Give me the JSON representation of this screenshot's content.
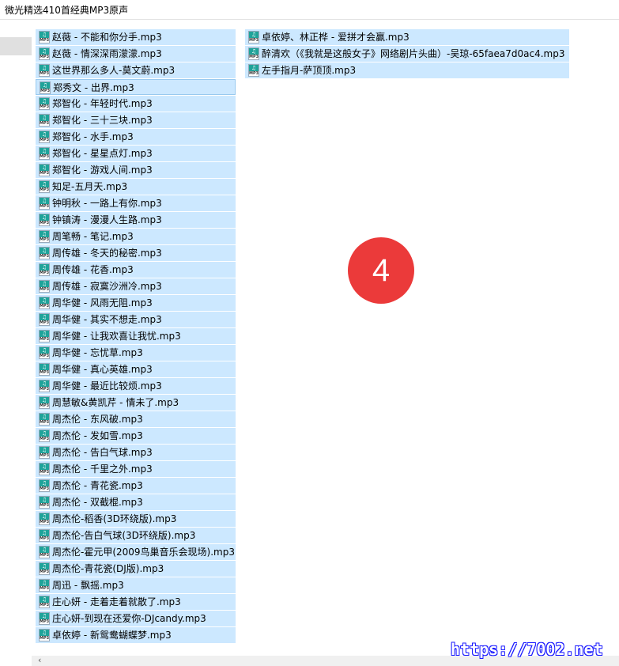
{
  "window": {
    "title": "微光精选410首经典MP3原声"
  },
  "icon_label": "MP3",
  "icon_name": "mp3-file-icon",
  "badge": {
    "number": "4",
    "color": "#eb3a3a"
  },
  "accent_selection_color": "#cce8ff",
  "watermark": "https://7002.net",
  "files": {
    "column1": [
      "赵薇 - 不能和你分手.mp3",
      "赵薇 - 情深深雨濛濛.mp3",
      "这世界那么多人-莫文蔚.mp3",
      "郑秀文 - 出界.mp3",
      "郑智化 - 年轻时代.mp3",
      "郑智化 - 三十三块.mp3",
      "郑智化 - 水手.mp3",
      "郑智化 - 星星点灯.mp3",
      "郑智化 - 游戏人间.mp3",
      "知足-五月天.mp3",
      "钟明秋 - 一路上有你.mp3",
      "钟镇涛 - 漫漫人生路.mp3",
      "周笔畅 - 笔记.mp3",
      "周传雄 - 冬天的秘密.mp3",
      "周传雄 - 花香.mp3",
      "周传雄 - 寂寞沙洲冷.mp3",
      "周华健 - 风雨无阻.mp3",
      "周华健 - 其实不想走.mp3",
      "周华健 - 让我欢喜让我忧.mp3",
      "周华健 - 忘忧草.mp3",
      "周华健 - 真心英雄.mp3",
      "周华健 - 最近比较烦.mp3",
      "周慧敏&黄凯芹 - 情未了.mp3",
      "周杰伦 - 东风破.mp3",
      "周杰伦 - 发如雪.mp3",
      "周杰伦 - 告白气球.mp3",
      "周杰伦 - 千里之外.mp3",
      "周杰伦 - 青花瓷.mp3",
      "周杰伦 - 双截棍.mp3",
      "周杰伦-稻香(3D环绕版).mp3",
      "周杰伦-告白气球(3D环绕版).mp3",
      "周杰伦-霍元甲(2009鸟巢音乐会现场).mp3",
      "周杰伦-青花瓷(DJ版).mp3",
      "周迅 - 飘摇.mp3",
      "庄心妍 - 走着走着就散了.mp3",
      "庄心妍-到现在还爱你-DJcandy.mp3",
      "卓依婷 - 新鸳鸯蝴蝶梦.mp3"
    ],
    "column2": [
      "卓依婷、林正桦 - 爱拼才会赢.mp3",
      "醉清欢（《我就是这般女子》网络剧片头曲）-吴琼-65faea7d0ac4.mp3",
      "左手指月-萨顶顶.mp3"
    ]
  }
}
